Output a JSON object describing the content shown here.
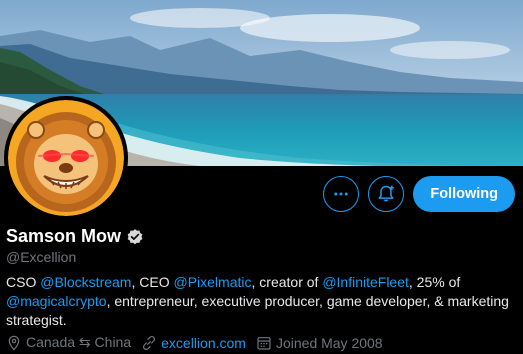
{
  "profile": {
    "name": "Samson Mow",
    "handle": "@Excellion",
    "verified": true,
    "follow_label": "Following",
    "bio": {
      "p1": "CSO ",
      "m1": "@Blockstream",
      "p2": ", CEO ",
      "m2": "@Pixelmatic",
      "p3": ", creator of ",
      "m3": "@InfiniteFleet",
      "p4": ", 25% of ",
      "m4": "@magicalcrypto",
      "p5": ", entrepreneur, executive producer, game developer, & marketing strategist."
    },
    "location": "Canada ⇆ China",
    "website": "excellion.com",
    "joined": "Joined May 2008"
  },
  "colors": {
    "accent": "#1d9bf0",
    "muted": "#71767b",
    "background": "#000000"
  },
  "icons": {
    "more": "more-icon",
    "notify": "bell-plus-icon",
    "verified": "verified-badge-icon",
    "location": "location-pin-icon",
    "link": "link-icon",
    "calendar": "calendar-icon"
  }
}
